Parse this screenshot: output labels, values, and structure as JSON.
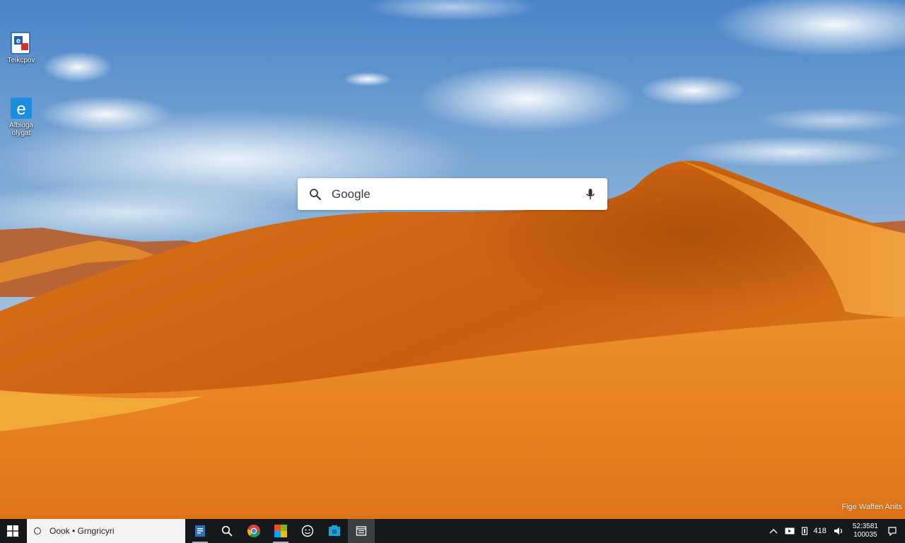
{
  "desktop": {
    "icons": [
      {
        "label": "Teikcpov"
      },
      {
        "label": "Afbioga\nolygat"
      }
    ]
  },
  "search_widget": {
    "text": "Google"
  },
  "watermark": {
    "text": "Fige Waffen Anits"
  },
  "taskbar": {
    "search_text": "Oook • Grngricyri",
    "apps": [
      {
        "icon": "document-icon"
      },
      {
        "icon": "search-icon"
      },
      {
        "icon": "chrome-icon"
      },
      {
        "icon": "office-icon"
      },
      {
        "icon": "feedback-icon"
      },
      {
        "icon": "store-icon"
      },
      {
        "icon": "window-icon"
      }
    ],
    "tray": {
      "network_text": "418",
      "clock_time": "52:3581",
      "clock_date": "100035"
    }
  },
  "colors": {
    "taskbar_bg": "#15191c",
    "sky_top": "#4c86c9",
    "dune_orange": "#e07a1c"
  }
}
